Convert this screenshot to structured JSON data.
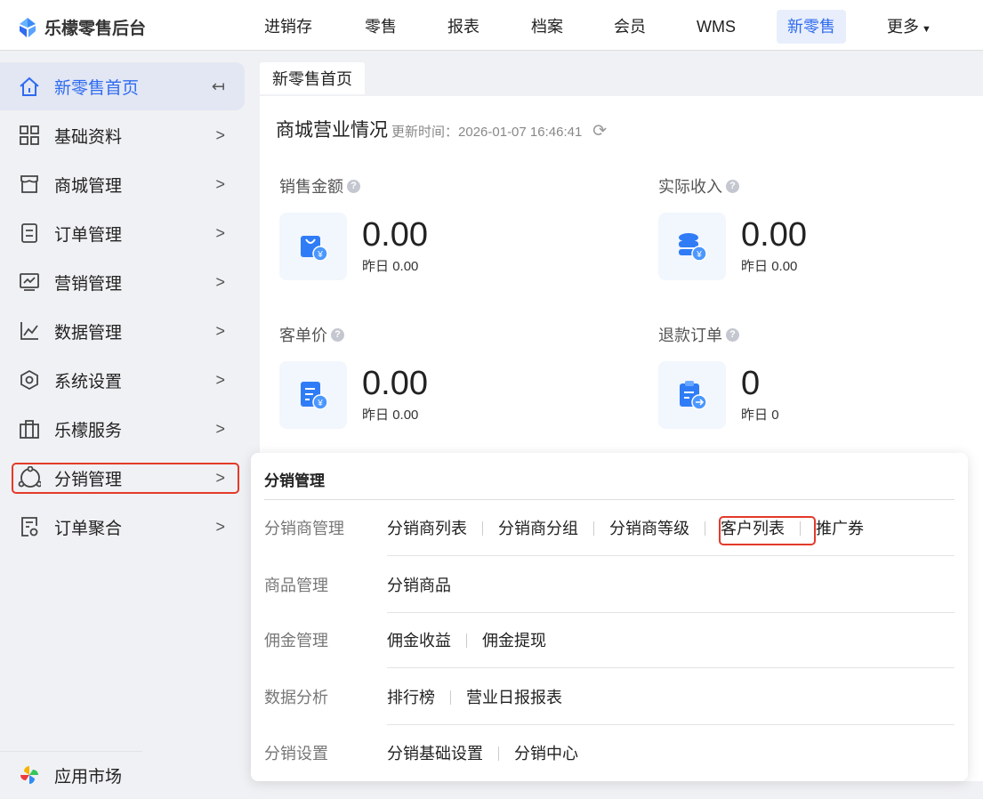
{
  "header": {
    "brand": "乐檬零售后台",
    "nav": [
      "进销存",
      "零售",
      "报表",
      "档案",
      "会员",
      "WMS",
      "新零售",
      "更多"
    ],
    "active_nav": "新零售"
  },
  "sidebar": {
    "items": [
      {
        "label": "新零售首页",
        "icon": "home-icon"
      },
      {
        "label": "基础资料",
        "icon": "grid-icon"
      },
      {
        "label": "商城管理",
        "icon": "store-icon"
      },
      {
        "label": "订单管理",
        "icon": "document-icon"
      },
      {
        "label": "营销管理",
        "icon": "monitor-icon"
      },
      {
        "label": "数据管理",
        "icon": "chart-icon"
      },
      {
        "label": "系统设置",
        "icon": "settings-icon"
      },
      {
        "label": "乐檬服务",
        "icon": "briefcase-icon"
      },
      {
        "label": "分销管理",
        "icon": "share-icon"
      },
      {
        "label": "订单聚合",
        "icon": "aggregate-icon"
      }
    ],
    "app_market": "应用市场"
  },
  "tab": "新零售首页",
  "overview": {
    "title": "商城营业情况",
    "update_label": "更新时间：",
    "update_time": "2026-01-07 16:46:41",
    "stats": [
      {
        "label": "销售金额",
        "value": "0.00",
        "yesterday_label": "昨日",
        "yesterday": "0.00"
      },
      {
        "label": "实际收入",
        "value": "0.00",
        "yesterday_label": "昨日",
        "yesterday": "0.00"
      },
      {
        "label": "客单价",
        "value": "0.00",
        "yesterday_label": "昨日",
        "yesterday": "0.00"
      },
      {
        "label": "退款订单",
        "value": "0",
        "yesterday_label": "昨日",
        "yesterday": "0"
      }
    ]
  },
  "popup": {
    "title": "分销管理",
    "rows": [
      {
        "label": "分销商管理",
        "links": [
          "分销商列表",
          "分销商分组",
          "分销商等级",
          "客户列表",
          "推广券"
        ]
      },
      {
        "label": "商品管理",
        "links": [
          "分销商品"
        ]
      },
      {
        "label": "佣金管理",
        "links": [
          "佣金收益",
          "佣金提现"
        ]
      },
      {
        "label": "数据分析",
        "links": [
          "排行榜",
          "营业日报报表"
        ]
      },
      {
        "label": "分销设置",
        "links": [
          "分销基础设置",
          "分销中心"
        ]
      }
    ]
  },
  "colors": {
    "accent": "#2f6bf0",
    "highlight": "#e33a2a"
  }
}
